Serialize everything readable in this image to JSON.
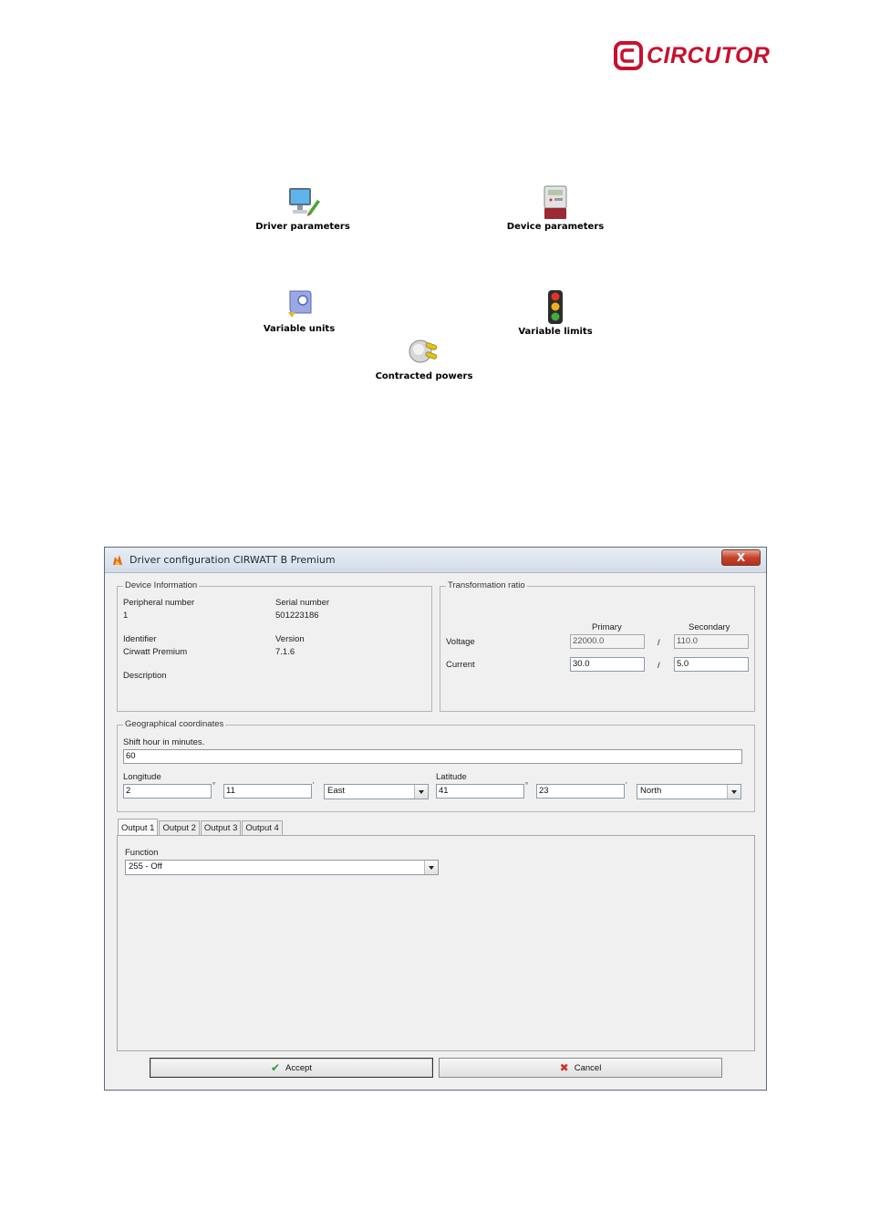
{
  "logo": {
    "text": "CIRCUTOR",
    "color": "#c8102e"
  },
  "launchers": [
    {
      "label": "Driver parameters",
      "icon": "monitor-edit-icon"
    },
    {
      "label": "Device parameters",
      "icon": "energy-meter-icon"
    },
    {
      "label": "Variable units",
      "icon": "units-icon"
    },
    {
      "label": "Variable limits",
      "icon": "traffic-light-icon"
    },
    {
      "label": "Contracted powers",
      "icon": "power-plug-icon"
    }
  ],
  "dialog": {
    "title": "Driver configuration CIRWATT B Premium",
    "close_label": "X",
    "device_info": {
      "legend": "Device Information",
      "peripheral_label": "Peripheral number",
      "peripheral_value": "1",
      "serial_label": "Serial number",
      "serial_value": "501223186",
      "identifier_label": "Identifier",
      "identifier_value": "Cirwatt Premium",
      "version_label": "Version",
      "version_value": "7.1.6",
      "description_label": "Description"
    },
    "transformation": {
      "legend": "Transformation ratio",
      "primary_label": "Primary",
      "secondary_label": "Secondary",
      "voltage_label": "Voltage",
      "voltage_primary": "22000.0",
      "voltage_secondary": "110.0",
      "current_label": "Current",
      "current_primary": "30.0",
      "current_secondary": "5.0",
      "separator": "/"
    },
    "geo": {
      "legend": "Geographical coordinates",
      "shift_label": "Shift hour in minutes.",
      "shift_value": "60",
      "longitude_label": "Longitude",
      "longitude_deg": "2",
      "longitude_min": "11",
      "longitude_dir": "East",
      "latitude_label": "Latitude",
      "latitude_deg": "41",
      "latitude_min": "23",
      "latitude_dir": "North",
      "deg_mark": "°",
      "min_mark": "'"
    },
    "tabs": [
      "Output 1",
      "Output 2",
      "Output 3",
      "Output 4"
    ],
    "function_label": "Function",
    "function_value": "255 - Off",
    "accept_label": "Accept",
    "cancel_label": "Cancel"
  }
}
